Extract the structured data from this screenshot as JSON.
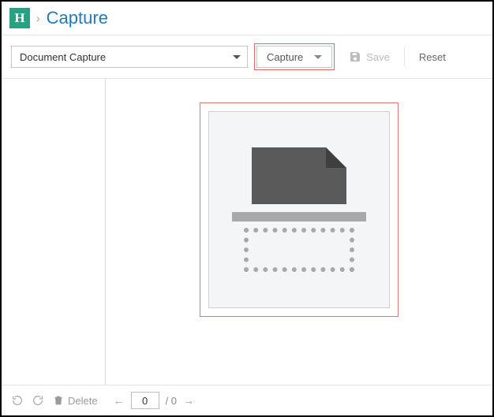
{
  "header": {
    "logo_text": "H",
    "breadcrumb_sep": "›",
    "title": "Capture"
  },
  "toolbar": {
    "document_dropdown": "Document Capture",
    "capture_label": "Capture",
    "save_label": "Save",
    "reset_label": "Reset"
  },
  "footer": {
    "delete_label": "Delete",
    "page_current": "0",
    "page_total": "/ 0"
  }
}
